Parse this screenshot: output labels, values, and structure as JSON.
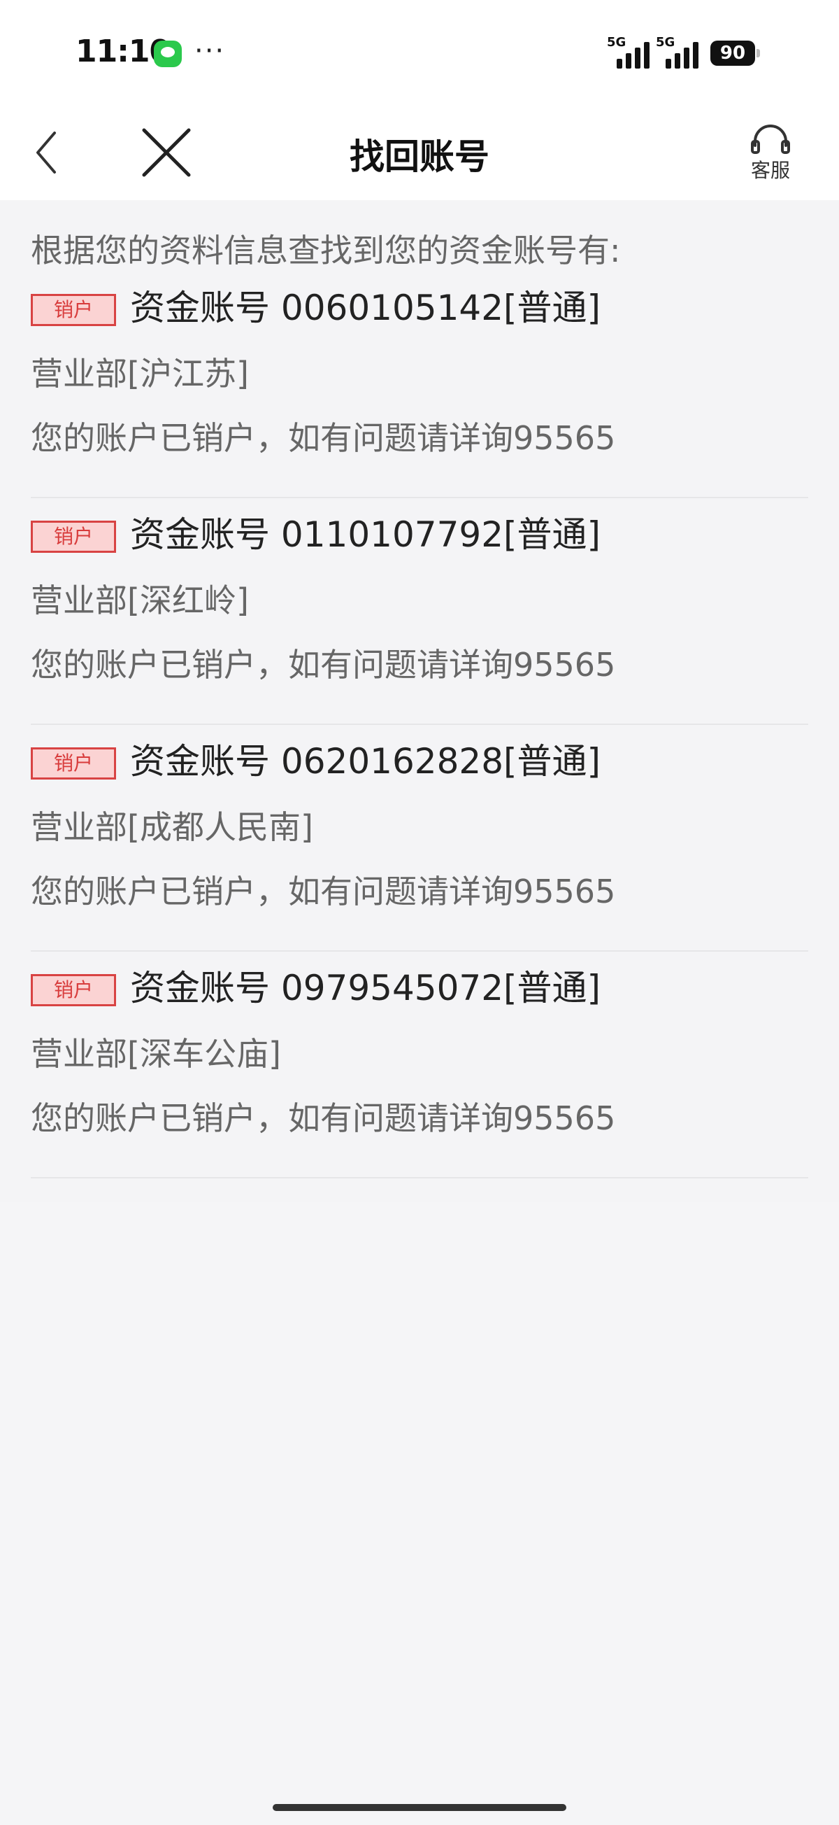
{
  "status_bar": {
    "time": "11:10",
    "more": "···",
    "signal_1_label": "5G",
    "signal_2_label": "5G",
    "battery_level": "90"
  },
  "nav": {
    "title": "找回账号",
    "service_label": "客服"
  },
  "intro": "根据您的资料信息查找到您的资金账号有:",
  "accounts": [
    {
      "badge": "销户",
      "account": "资金账号 0060105142[普通]",
      "branch": "营业部[沪江苏]",
      "notice": "您的账户已销户，如有问题请详询95565"
    },
    {
      "badge": "销户",
      "account": "资金账号 0110107792[普通]",
      "branch": "营业部[深红岭]",
      "notice": "您的账户已销户，如有问题请详询95565"
    },
    {
      "badge": "销户",
      "account": "资金账号 0620162828[普通]",
      "branch": "营业部[成都人民南]",
      "notice": "您的账户已销户，如有问题请详询95565"
    },
    {
      "badge": "销户",
      "account": "资金账号 0979545072[普通]",
      "branch": "营业部[深车公庙]",
      "notice": "您的账户已销户，如有问题请详询95565"
    }
  ],
  "colors": {
    "badge_border": "#d84343",
    "badge_fill": "#fbd3d3",
    "background": "#f5f5f7"
  }
}
